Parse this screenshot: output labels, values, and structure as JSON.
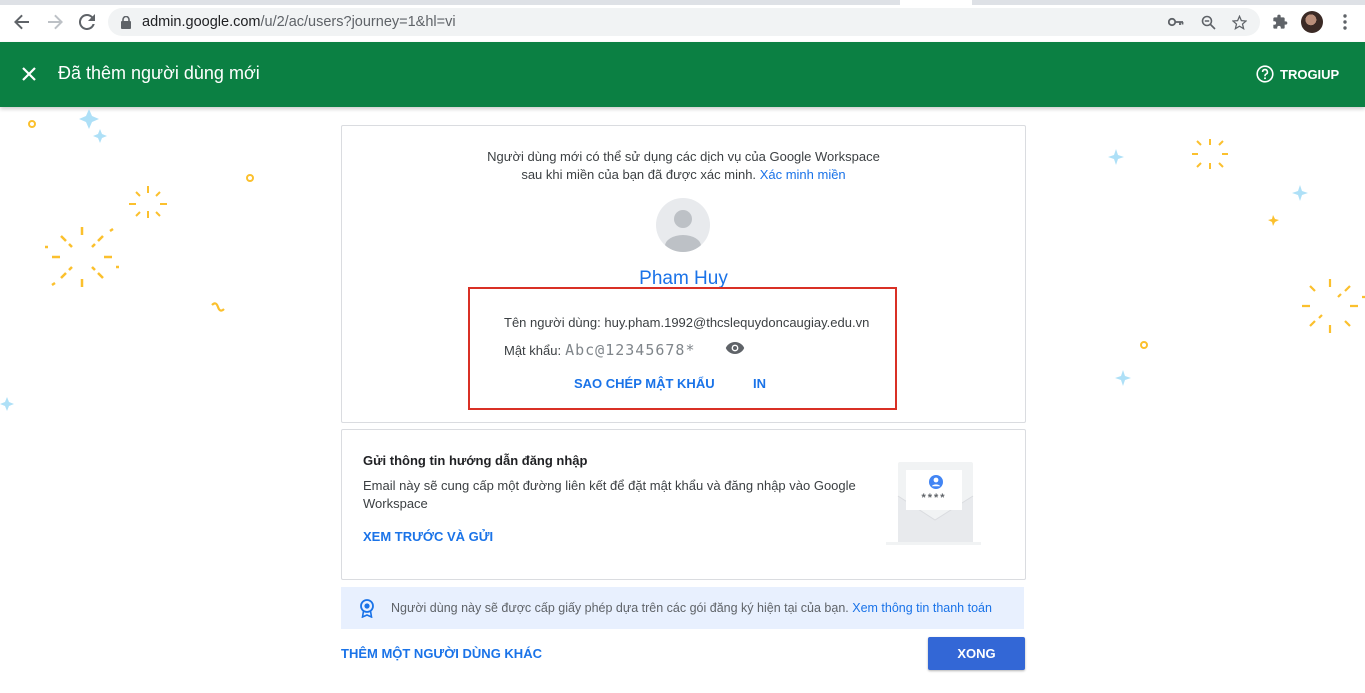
{
  "browser": {
    "url_host": "admin.google.com",
    "url_path": "/u/2/ac/users?journey=1&hl=vi"
  },
  "header": {
    "title": "Đã thêm người dùng mới",
    "help_label": "TROGIUP"
  },
  "confirm_card": {
    "info_line1": "Người dùng mới có thể sử dụng các dịch vụ của Google Workspace",
    "info_line2": "sau khi miền của bạn đã được xác minh.",
    "verify_link": "Xác minh miền",
    "user_name": "Pham Huy",
    "username_label": "Tên người dùng:",
    "username_value": "huy.pham.1992@thcslequydoncaugiay.edu.vn",
    "password_label": "Mật khẩu:",
    "password_value": "Abc@12345678*",
    "copy_password": "SAO CHÉP MẬT KHẨU",
    "print": "IN"
  },
  "login_card": {
    "heading": "Gửi thông tin hướng dẫn đăng nhập",
    "description": "Email này sẽ cung cấp một đường liên kết để đặt mật khẩu và đăng nhập vào Google Workspace",
    "preview_send": "XEM TRƯỚC VÀ GỬI",
    "envelope_stars": "****"
  },
  "license_banner": {
    "text": "Người dùng này sẽ được cấp giấy phép dựa trên các gói đăng ký hiện tại của bạn.",
    "link": "Xem thông tin thanh toán"
  },
  "footer": {
    "add_another": "THÊM MỘT NGƯỜI DÙNG KHÁC",
    "done": "XONG"
  },
  "colors": {
    "header_green": "#0b8043",
    "link_blue": "#1a73e8",
    "done_blue": "#3367d6",
    "highlight_red": "#d93025",
    "confetti_yellow": "#fbc02d",
    "confetti_blue": "#aee0f7"
  }
}
